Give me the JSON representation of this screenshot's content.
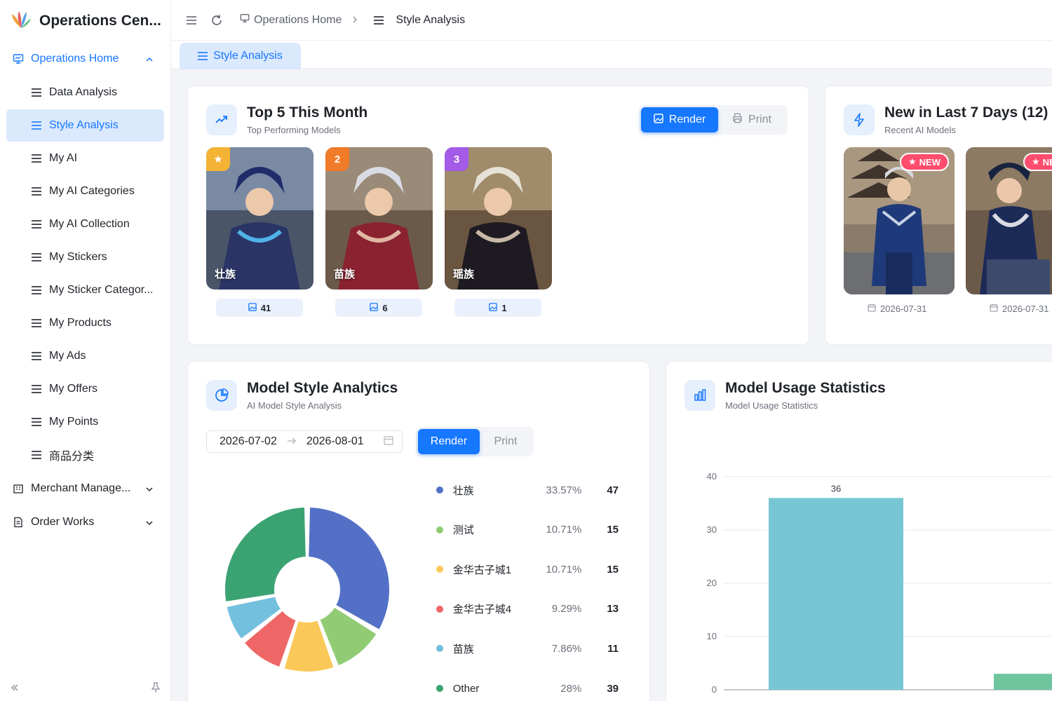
{
  "app": {
    "title": "Operations Cen..."
  },
  "sidebar": {
    "group_home": "Operations Home",
    "items": [
      {
        "label": "Data Analysis",
        "active": false
      },
      {
        "label": "Style Analysis",
        "active": true
      },
      {
        "label": "My AI",
        "active": false
      },
      {
        "label": "My AI Categories",
        "active": false
      },
      {
        "label": "My AI Collection",
        "active": false
      },
      {
        "label": "My Stickers",
        "active": false
      },
      {
        "label": "My Sticker Categor...",
        "active": false
      },
      {
        "label": "My Products",
        "active": false
      },
      {
        "label": "My Ads",
        "active": false
      },
      {
        "label": "My Offers",
        "active": false
      },
      {
        "label": "My Points",
        "active": false
      },
      {
        "label": "商品分类",
        "active": false
      }
    ],
    "group_merchant": "Merchant Manage...",
    "group_order": "Order Works",
    "collapse_icon": "double-chevron-left-icon",
    "pin_icon": "pin-icon"
  },
  "header": {
    "breadcrumb_home": "Operations Home",
    "breadcrumb_current": "Style Analysis",
    "tab_label": "Style Analysis"
  },
  "top5": {
    "title": "Top 5 This Month",
    "subtitle": "Top Performing Models",
    "render_label": "Render",
    "print_label": "Print",
    "items": [
      {
        "rank": "★",
        "name": "壮族",
        "count": "41",
        "rank_color": "#f5b335"
      },
      {
        "rank": "2",
        "name": "苗族",
        "count": "6",
        "rank_color": "#f07b28"
      },
      {
        "rank": "3",
        "name": "瑶族",
        "count": "1",
        "rank_color": "#a45be8"
      }
    ]
  },
  "new7": {
    "title": "New in Last 7 Days (12)",
    "subtitle": "Recent AI Models",
    "badge": "NEW",
    "badge_partial": "NE",
    "dates": [
      "2026-07-31",
      "2026-07-31"
    ]
  },
  "style_analytics": {
    "title": "Model Style Analytics",
    "subtitle": "AI Model Style Analysis",
    "date_start": "2026-07-02",
    "date_end": "2026-08-01",
    "render_label": "Render",
    "print_label": "Print",
    "legend": [
      {
        "name": "壮族",
        "pct": "33.57%",
        "value": "47",
        "color": "#5470c6"
      },
      {
        "name": "测试",
        "pct": "10.71%",
        "value": "15",
        "color": "#91cc75"
      },
      {
        "name": "金华古子城1",
        "pct": "10.71%",
        "value": "15",
        "color": "#fac858"
      },
      {
        "name": "金华古子城4",
        "pct": "9.29%",
        "value": "13",
        "color": "#ee6666"
      },
      {
        "name": "苗族",
        "pct": "7.86%",
        "value": "11",
        "color": "#73c0de"
      },
      {
        "name": "Other",
        "pct": "28%",
        "value": "39",
        "color": "#3ba272"
      }
    ]
  },
  "usage_stats": {
    "title": "Model Usage Statistics",
    "subtitle": "Model Usage Statistics"
  },
  "chart_data": {
    "type": "bar",
    "title": "Model Usage Statistics",
    "ylim": [
      0,
      40
    ],
    "yticks": [
      "0",
      "10",
      "20",
      "30",
      "40"
    ],
    "values": [
      36,
      3
    ],
    "data_labels": [
      "36",
      ""
    ],
    "colors": [
      "#76c7d3",
      "#6fc59e"
    ],
    "grid": true
  },
  "colors": {
    "accent": "#1677ff",
    "accent_light": "#dbe9fd"
  }
}
